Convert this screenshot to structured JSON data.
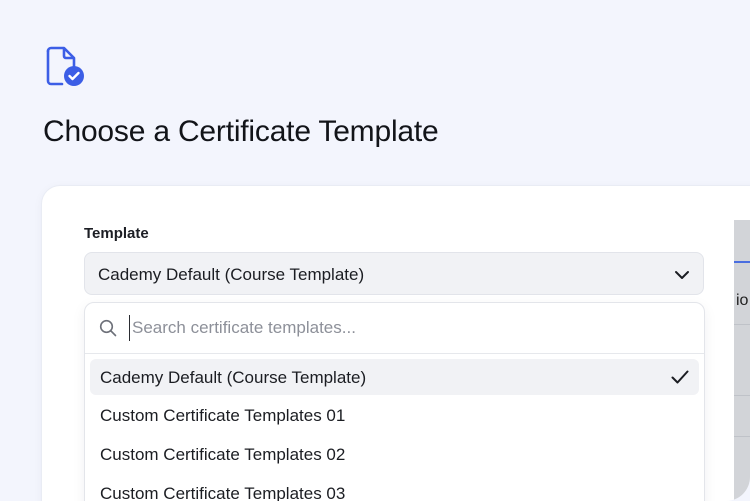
{
  "header": {
    "title": "Choose a Certificate Template",
    "icon": "document-check-icon",
    "accent_color": "#3c5ee6"
  },
  "form": {
    "label": "Template",
    "select": {
      "value": "Cademy Default (Course Template)",
      "icon": "chevron-down-icon"
    },
    "dropdown": {
      "search_placeholder": "Search certificate templates...",
      "search_value": "",
      "options": [
        {
          "label": "Cademy Default (Course Template)",
          "selected": true
        },
        {
          "label": "Custom Certificate Templates 01",
          "selected": false
        },
        {
          "label": "Custom Certificate Templates 02",
          "selected": false
        },
        {
          "label": "Custom Certificate Templates 03",
          "selected": false
        }
      ]
    }
  },
  "side_panel": {
    "glyph": "io"
  }
}
